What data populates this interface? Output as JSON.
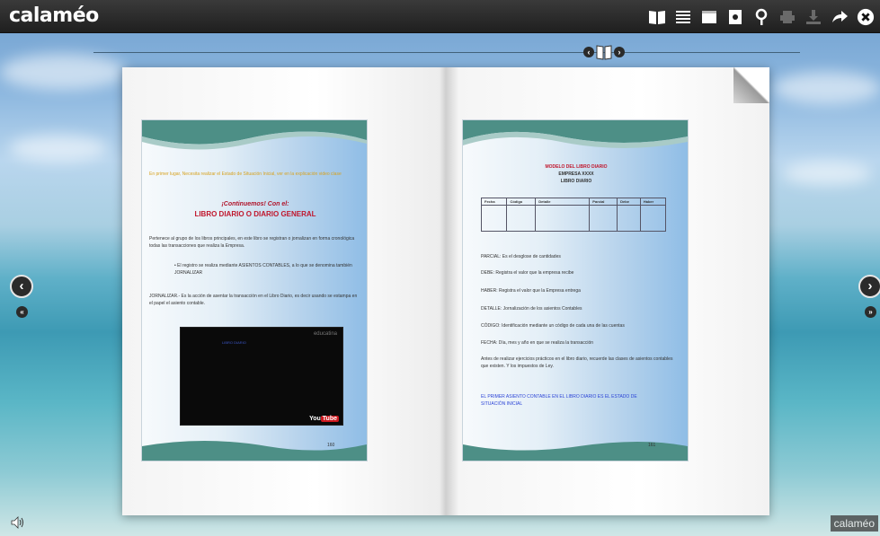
{
  "app": {
    "logo": "calaméo",
    "watermark": "calaméo"
  },
  "toolbar": {
    "icons": [
      "book-icon",
      "list-icon",
      "fullscreen-icon",
      "page-icon",
      "search-icon",
      "print-icon",
      "download-icon",
      "share-icon",
      "close-icon"
    ]
  },
  "left_page": {
    "intro": "En primer lugar,  Necesita  realizar el Estado de Situación Inicial, ver en la explicación video clase",
    "heading": "¡Continuemos!  Con el:",
    "title": "LIBRO DIARIO O DIARIO GENERAL",
    "para1": "Pertenece al grupo de los libros principales, en este libro se registran o jornalizan  en forma cronológica todas las transacciones que realiza  la Empresa.",
    "bullet": "•   El registro se realiza mediante ASIENTOS CONTABLES, a lo que se denomina también JORNALIZAR",
    "para2": "JORNALIZAR.-  Es la acción de asentar la transacción en el Libro Diario, es decir usando se estampa en el papel el asiento contable.",
    "video_brand": "educatina",
    "video_link": "LIBRO DIARIO",
    "youtube_you": "You",
    "youtube_tube": "Tube",
    "page_number": "160"
  },
  "right_page": {
    "title1": "MODELO DEL LIBRO DIARIO",
    "title2": "EMPRESA  XXXX",
    "title3": "LIBRO DIARIO",
    "table_headers": [
      "Fecha",
      "Código",
      "Detalle",
      "Parcial",
      "Debe",
      "Haber"
    ],
    "def_parcial": "PARCIAL: Es  el desglose de cantidades",
    "def_debe": "DEBE:  Registra el valor que la empresa recibe",
    "def_haber": "HABER:  Registra el valor que la Empresa entrega",
    "def_detalle": "DETALLE: Jornalización de los asientos Contables",
    "def_codigo": "CÓDIGO:  Identificación mediante un código de cada una de las cuentas",
    "def_fecha": "FECHA: Día, mes y año en que se realiza la transacción",
    "para": "Antes de realizar ejercicios prácticos en el libro diario, recuerde las clases de asientos contables  que existen.  Y los impuestos de Ley.",
    "closing": "EL PRIMER ASIENTO CONTABLE EN EL LIBRO DIARIO ES EL ESTADO DE SITUACIÓN INICIAL",
    "page_number": "161"
  }
}
